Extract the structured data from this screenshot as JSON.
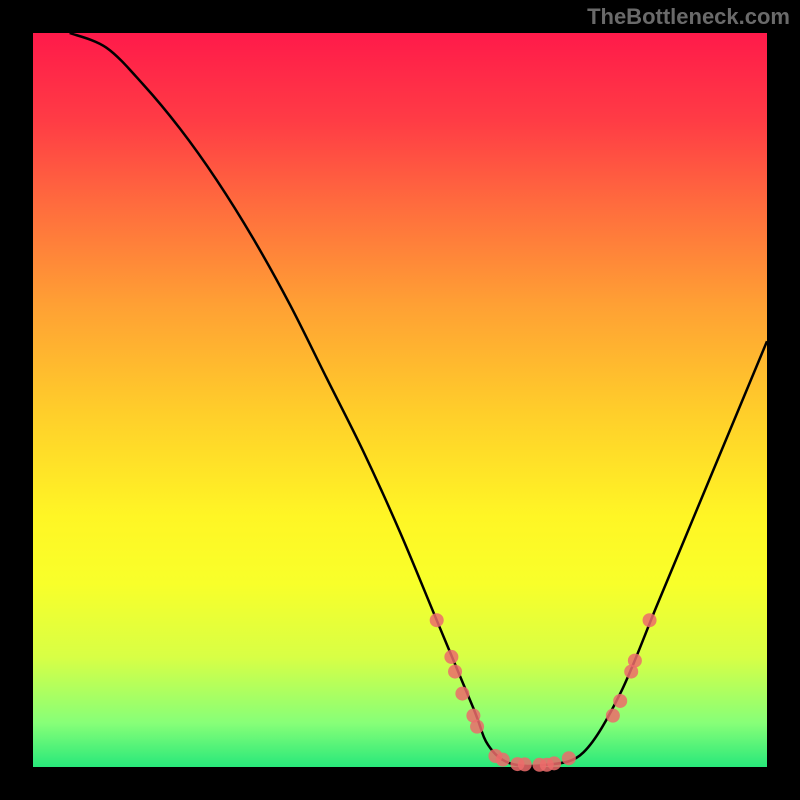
{
  "watermark": "TheBottleneck.com",
  "chart_data": {
    "type": "line",
    "title": "",
    "xlabel": "",
    "ylabel": "",
    "xlim": [
      0,
      100
    ],
    "ylim": [
      0,
      100
    ],
    "curve": {
      "x": [
        5,
        10,
        15,
        20,
        25,
        30,
        35,
        40,
        45,
        50,
        55,
        60,
        62,
        65,
        70,
        75,
        80,
        85,
        90,
        95,
        100
      ],
      "y": [
        100,
        98,
        93,
        87,
        80,
        72,
        63,
        53,
        43,
        32,
        20,
        8,
        3,
        0.5,
        0.3,
        2,
        10,
        22,
        34,
        46,
        58
      ]
    },
    "markers": [
      {
        "x": 55,
        "y": 20
      },
      {
        "x": 57,
        "y": 15
      },
      {
        "x": 57.5,
        "y": 13
      },
      {
        "x": 58.5,
        "y": 10
      },
      {
        "x": 60,
        "y": 7
      },
      {
        "x": 60.5,
        "y": 5.5
      },
      {
        "x": 63,
        "y": 1.5
      },
      {
        "x": 64,
        "y": 1
      },
      {
        "x": 66,
        "y": 0.4
      },
      {
        "x": 67,
        "y": 0.35
      },
      {
        "x": 69,
        "y": 0.3
      },
      {
        "x": 70,
        "y": 0.3
      },
      {
        "x": 71,
        "y": 0.5
      },
      {
        "x": 73,
        "y": 1.2
      },
      {
        "x": 79,
        "y": 7
      },
      {
        "x": 80,
        "y": 9
      },
      {
        "x": 81.5,
        "y": 13
      },
      {
        "x": 82,
        "y": 14.5
      },
      {
        "x": 84,
        "y": 20
      }
    ],
    "marker_color": "#ec6b6b",
    "curve_color": "#000000",
    "gradient": {
      "top": "#ff1a4a",
      "bottom": "#28e87a"
    }
  }
}
